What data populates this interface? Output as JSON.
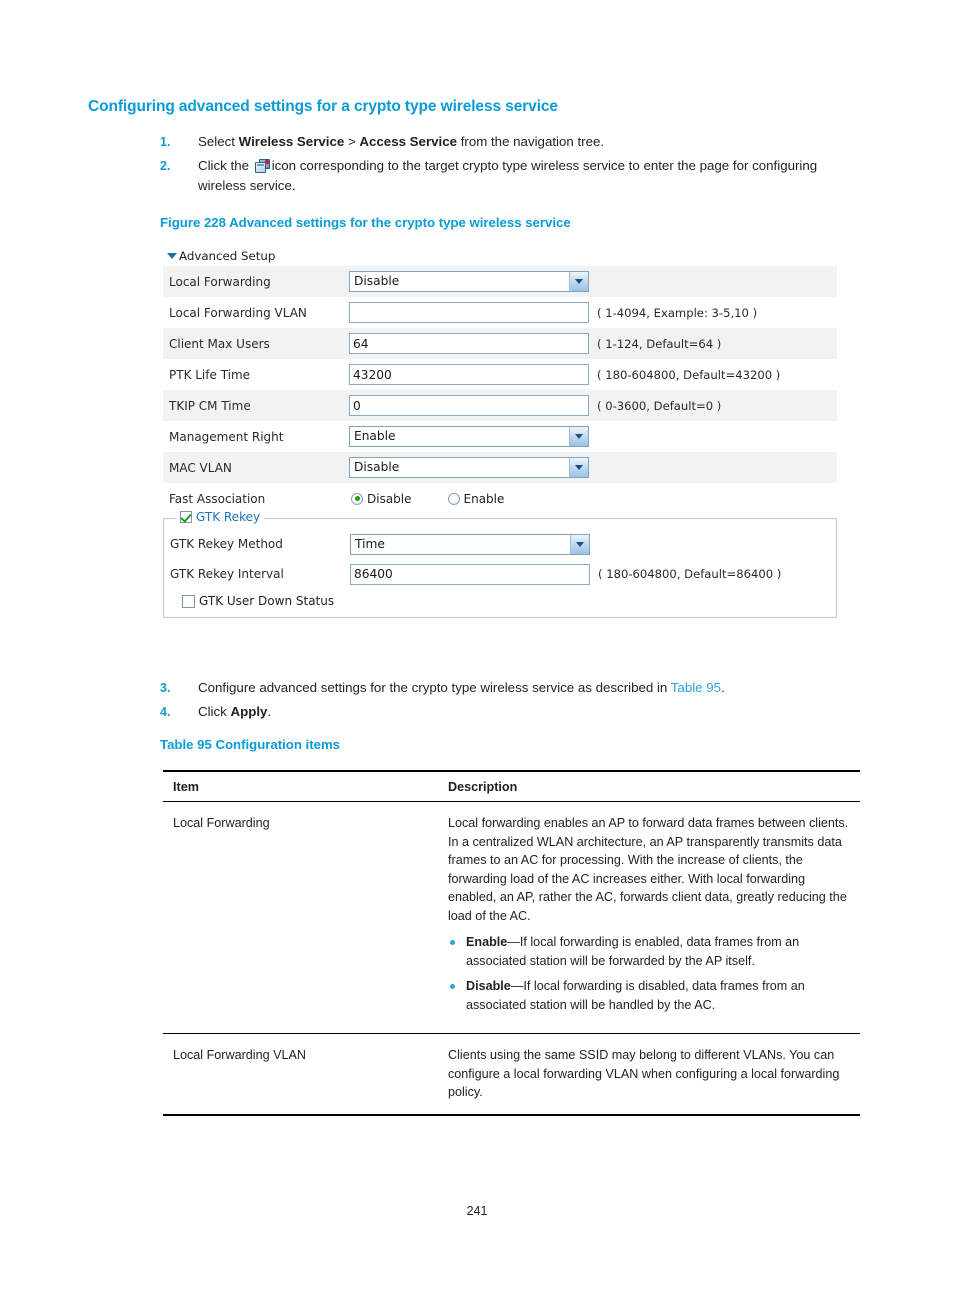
{
  "document": {
    "section_heading": "Configuring advanced settings for a crypto type wireless service",
    "page_number": "241"
  },
  "steps": [
    {
      "number": "1.",
      "parts": [
        {
          "t": "Select ",
          "b": false
        },
        {
          "t": "Wireless Service",
          "b": true
        },
        {
          "t": " > ",
          "b": false
        },
        {
          "t": "Access Service",
          "b": true
        },
        {
          "t": " from the navigation tree.",
          "b": false
        }
      ]
    },
    {
      "number": "2.",
      "prefix": "Click the ",
      "icon": "wireless-service-config-icon",
      "suffix": "icon corresponding to the target crypto type wireless service to enter the page for configuring wireless service."
    }
  ],
  "figure": {
    "caption": "Figure 228 Advanced settings for the crypto type wireless service",
    "panel_title": "Advanced Setup",
    "rows": [
      {
        "label": "Local Forwarding",
        "control": "select",
        "value": "Disable",
        "hint": ""
      },
      {
        "label": "Local Forwarding VLAN",
        "control": "text",
        "value": "",
        "hint": "( 1-4094, Example: 3-5,10 )"
      },
      {
        "label": "Client Max Users",
        "control": "text",
        "value": "64",
        "hint": "( 1-124, Default=64 )"
      },
      {
        "label": "PTK Life Time",
        "control": "text",
        "value": "43200",
        "hint": "( 180-604800, Default=43200 )"
      },
      {
        "label": "TKIP CM Time",
        "control": "text",
        "value": "0",
        "hint": "( 0-3600, Default=0 )"
      },
      {
        "label": "Management Right",
        "control": "select",
        "value": "Enable",
        "hint": ""
      },
      {
        "label": "MAC VLAN",
        "control": "select",
        "value": "Disable",
        "hint": ""
      }
    ],
    "fast_association": {
      "label": "Fast Association",
      "options": [
        {
          "label": "Disable",
          "selected": true
        },
        {
          "label": "Enable",
          "selected": false
        }
      ]
    },
    "gtk_rekey": {
      "legend": "GTK Rekey",
      "legend_checked": true,
      "method": {
        "label": "GTK Rekey Method",
        "value": "Time"
      },
      "interval": {
        "label": "GTK Rekey Interval",
        "value": "86400",
        "hint": "( 180-604800, Default=86400 )"
      },
      "user_down_status": {
        "label": "GTK User Down Status",
        "checked": false
      }
    }
  },
  "steps2": [
    {
      "number": "3.",
      "prefix": "Configure advanced settings for the crypto type wireless service as described in ",
      "link": "Table 95",
      "suffix": "."
    },
    {
      "number": "4.",
      "prefix": "Click ",
      "bold": "Apply",
      "suffix": "."
    }
  ],
  "table": {
    "caption": "Table 95 Configuration items",
    "headers": {
      "item": "Item",
      "description": "Description"
    },
    "rows": [
      {
        "item": "Local Forwarding",
        "paragraph": "Local forwarding enables an AP to forward data frames between clients. In a centralized WLAN architecture, an AP transparently transmits data frames to an AC for processing. With the increase of clients, the forwarding load of the AC increases either. With local forwarding enabled, an AP, rather the AC, forwards client data, greatly reducing the load of the AC.",
        "bullets": [
          {
            "term": "Enable",
            "text": "—If local forwarding is enabled, data frames from an associated station will be forwarded by the AP itself."
          },
          {
            "term": "Disable",
            "text": "—If local forwarding is disabled, data frames from an associated station will be handled by the AC."
          }
        ]
      },
      {
        "item": "Local Forwarding VLAN",
        "paragraph": "Clients using the same SSID may belong to different VLANs. You can configure a local forwarding VLAN when configuring a local forwarding policy.",
        "bullets": []
      }
    ]
  },
  "colors": {
    "heading_blue": "#0b9bd7",
    "link_blue": "#2ba4dd",
    "row_alt": "#f2f2f2",
    "radio_green": "#1f9d1f"
  }
}
